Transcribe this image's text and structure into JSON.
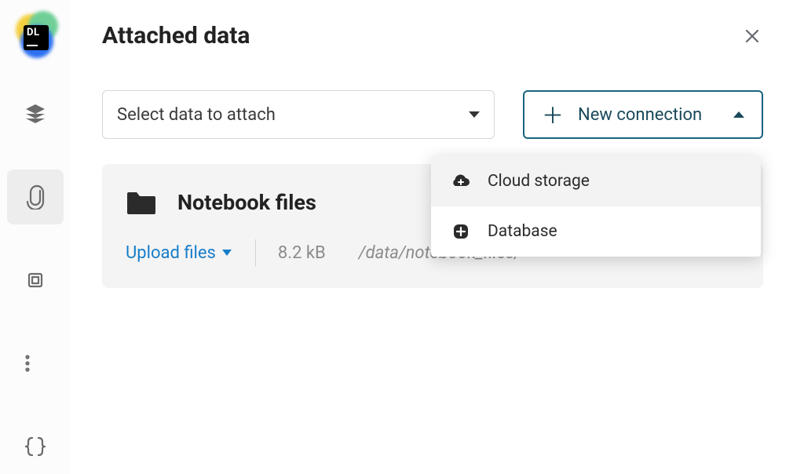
{
  "header": {
    "title": "Attached data"
  },
  "logo": {
    "text": "DL"
  },
  "sidebar": {
    "items": [
      {
        "name": "layers",
        "active": false
      },
      {
        "name": "attachment",
        "active": true
      },
      {
        "name": "chip",
        "active": false
      },
      {
        "name": "list",
        "active": false
      },
      {
        "name": "braces",
        "active": false
      }
    ]
  },
  "toolbar": {
    "select_placeholder": "Select data to attach",
    "new_connection_label": "New connection"
  },
  "dropdown": {
    "items": [
      {
        "label": "Cloud storage",
        "icon": "cloud-plus",
        "hover": true
      },
      {
        "label": "Database",
        "icon": "db-plus",
        "hover": false
      }
    ]
  },
  "card": {
    "title": "Notebook files",
    "upload_label": "Upload files",
    "size": "8.2 kB",
    "path": "/data/notebook_files/"
  }
}
